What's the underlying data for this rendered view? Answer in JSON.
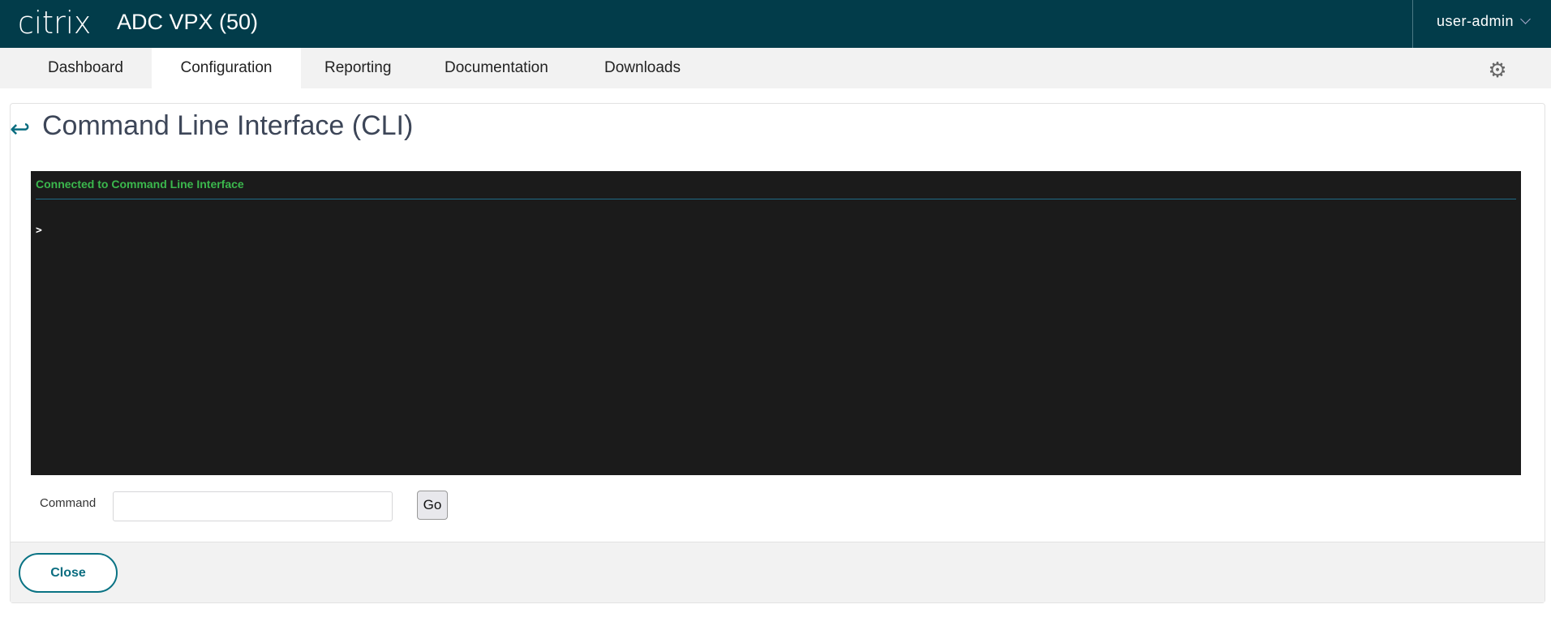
{
  "header": {
    "logo": "citrix",
    "app_title": "ADC VPX (50)",
    "user": "user-admin"
  },
  "nav": {
    "tabs": [
      {
        "label": "Dashboard"
      },
      {
        "label": "Configuration"
      },
      {
        "label": "Reporting"
      },
      {
        "label": "Documentation"
      },
      {
        "label": "Downloads"
      }
    ],
    "active": "Configuration"
  },
  "page": {
    "title": "Command Line Interface (CLI)"
  },
  "terminal": {
    "status": "Connected to Command Line Interface",
    "prompt": ">"
  },
  "command": {
    "label": "Command",
    "value": "",
    "go_label": "Go"
  },
  "footer": {
    "close_label": "Close"
  },
  "colors": {
    "header_bg": "#023c4a",
    "accent": "#0a7384",
    "terminal_bg": "#1b1b1b",
    "status_green": "#3bb84d"
  }
}
